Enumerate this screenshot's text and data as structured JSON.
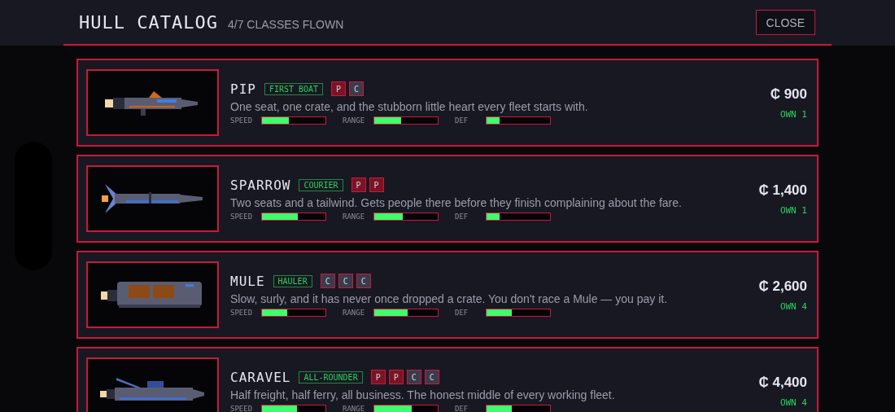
{
  "header": {
    "title": "HULL CATALOG",
    "subtitle": "4/7 CLASSES FLOWN",
    "close_button": "CLOSE"
  },
  "ships": [
    {
      "kind": "skiff",
      "name": "PIP",
      "role": "FIRST BOAT",
      "slots": [
        {
          "label": "P",
          "kind": "passenger"
        },
        {
          "label": "C",
          "kind": "cargo"
        }
      ],
      "description": "One seat, one crate, and the stubborn little heart every fleet starts with.",
      "stats": [
        {
          "label": "SPEED",
          "level": 0.42
        },
        {
          "label": "RANGE",
          "level": 0.42
        },
        {
          "label": "DEF",
          "level": 0.2
        }
      ],
      "price": "₵ 900",
      "owned": "OWN 1"
    },
    {
      "kind": "dart",
      "name": "SPARROW",
      "role": "COURIER",
      "slots": [
        {
          "label": "P",
          "kind": "passenger"
        },
        {
          "label": "P",
          "kind": "passenger"
        }
      ],
      "description": "Two seats and a tailwind. Gets people there before they finish complaining about the fare.",
      "stats": [
        {
          "label": "SPEED",
          "level": 0.57
        },
        {
          "label": "RANGE",
          "level": 0.45
        },
        {
          "label": "DEF",
          "level": 0.2
        }
      ],
      "price": "₵ 1,400",
      "owned": "OWN 1"
    },
    {
      "kind": "barge",
      "name": "MULE",
      "role": "HAULER",
      "slots": [
        {
          "label": "C",
          "kind": "cargo"
        },
        {
          "label": "C",
          "kind": "cargo"
        },
        {
          "label": "C",
          "kind": "cargo"
        }
      ],
      "description": "Slow, surly, and it has never once dropped a crate. You don't race a Mule — you pay it.",
      "stats": [
        {
          "label": "SPEED",
          "level": 0.4
        },
        {
          "label": "RANGE",
          "level": 0.52
        },
        {
          "label": "DEF",
          "level": 0.4
        }
      ],
      "price": "₵ 2,600",
      "owned": "OWN 4"
    },
    {
      "kind": "cruiser",
      "name": "CARAVEL",
      "role": "ALL-ROUNDER",
      "slots": [
        {
          "label": "P",
          "kind": "passenger"
        },
        {
          "label": "P",
          "kind": "passenger"
        },
        {
          "label": "C",
          "kind": "cargo"
        },
        {
          "label": "C",
          "kind": "cargo"
        }
      ],
      "description": "Half freight, half ferry, all business. The honest middle of every working fleet.",
      "stats": [
        {
          "label": "SPEED",
          "level": 0.55
        },
        {
          "label": "RANGE",
          "level": 0.59
        },
        {
          "label": "DEF",
          "level": 0.4
        }
      ],
      "price": "₵ 4,400",
      "owned": "OWN 4"
    }
  ]
}
